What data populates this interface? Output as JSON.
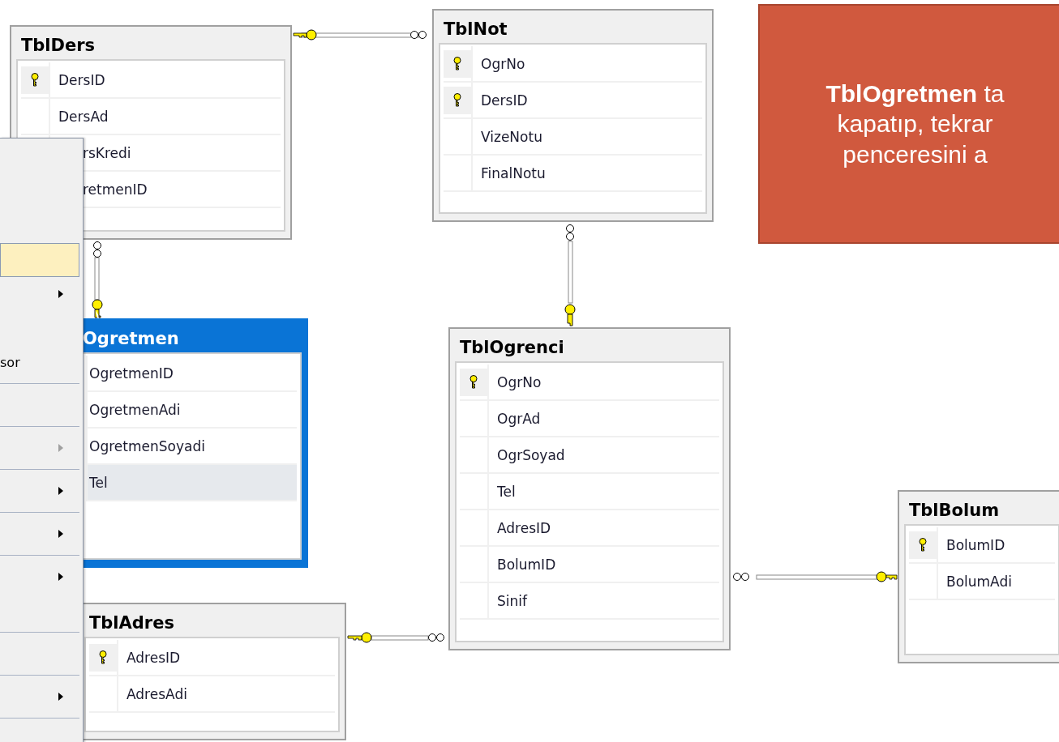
{
  "tables": [
    {
      "name": "TblDers",
      "selected": false,
      "columns": [
        {
          "name": "DersID",
          "primary_key": true,
          "selected": false
        },
        {
          "name": "DersAd",
          "primary_key": false,
          "selected": false
        },
        {
          "name": "rsKredi",
          "primary_key": false,
          "selected": false
        },
        {
          "name": "retmenID",
          "primary_key": false,
          "selected": false
        }
      ]
    },
    {
      "name": "TblNot",
      "selected": false,
      "columns": [
        {
          "name": "OgrNo",
          "primary_key": true,
          "selected": false
        },
        {
          "name": "DersID",
          "primary_key": true,
          "selected": false
        },
        {
          "name": "VizeNotu",
          "primary_key": false,
          "selected": false
        },
        {
          "name": "FinalNotu",
          "primary_key": false,
          "selected": false
        }
      ]
    },
    {
      "name": "Ogretmen",
      "selected": true,
      "columns": [
        {
          "name": "OgretmenID",
          "selected": false
        },
        {
          "name": "OgretmenAdi",
          "selected": false
        },
        {
          "name": "OgretmenSoyadi",
          "selected": false
        },
        {
          "name": "Tel",
          "selected": true
        }
      ]
    },
    {
      "name": "TblOgrenci",
      "selected": false,
      "columns": [
        {
          "name": "OgrNo",
          "primary_key": true,
          "selected": false
        },
        {
          "name": "OgrAd",
          "primary_key": false,
          "selected": false
        },
        {
          "name": "OgrSoyad",
          "primary_key": false,
          "selected": false
        },
        {
          "name": "Tel",
          "primary_key": false,
          "selected": false
        },
        {
          "name": "AdresID",
          "primary_key": false,
          "selected": false
        },
        {
          "name": "BolumID",
          "primary_key": false,
          "selected": false
        },
        {
          "name": "Sinif",
          "primary_key": false,
          "selected": false
        }
      ]
    },
    {
      "name": "TblAdres",
      "selected": false,
      "columns": [
        {
          "name": "AdresID",
          "primary_key": true,
          "selected": false
        },
        {
          "name": "AdresAdi",
          "primary_key": false,
          "selected": false
        }
      ]
    },
    {
      "name": "TblBolum",
      "selected": false,
      "columns": [
        {
          "name": "BolumID",
          "primary_key": true,
          "selected": false
        },
        {
          "name": "BolumAdi",
          "primary_key": false,
          "selected": false
        }
      ]
    }
  ],
  "context_menu": [
    {
      "kind": "spacer"
    },
    {
      "kind": "spacer"
    },
    {
      "kind": "spacer"
    },
    {
      "kind": "item",
      "selected": true
    },
    {
      "kind": "item",
      "selected": false,
      "submenu": true,
      "disabled": false
    },
    {
      "kind": "spacer"
    },
    {
      "kind": "item",
      "label": "sor",
      "selected": false
    },
    {
      "kind": "separator"
    },
    {
      "kind": "spacer"
    },
    {
      "kind": "separator"
    },
    {
      "kind": "item",
      "selected": false,
      "submenu": true,
      "disabled": true
    },
    {
      "kind": "separator"
    },
    {
      "kind": "item",
      "selected": false,
      "submenu": true,
      "disabled": false
    },
    {
      "kind": "separator"
    },
    {
      "kind": "item",
      "selected": false,
      "submenu": true,
      "disabled": false
    },
    {
      "kind": "separator"
    },
    {
      "kind": "item",
      "selected": false,
      "submenu": true,
      "disabled": false
    },
    {
      "kind": "spacer"
    },
    {
      "kind": "separator"
    },
    {
      "kind": "spacer"
    },
    {
      "kind": "separator"
    },
    {
      "kind": "item",
      "selected": false,
      "submenu": true,
      "disabled": false
    },
    {
      "kind": "separator"
    },
    {
      "kind": "spacer"
    }
  ],
  "callout": {
    "text": "**TblOgretmen** ta\nkapatıp, tekrar\npenceresini a"
  }
}
